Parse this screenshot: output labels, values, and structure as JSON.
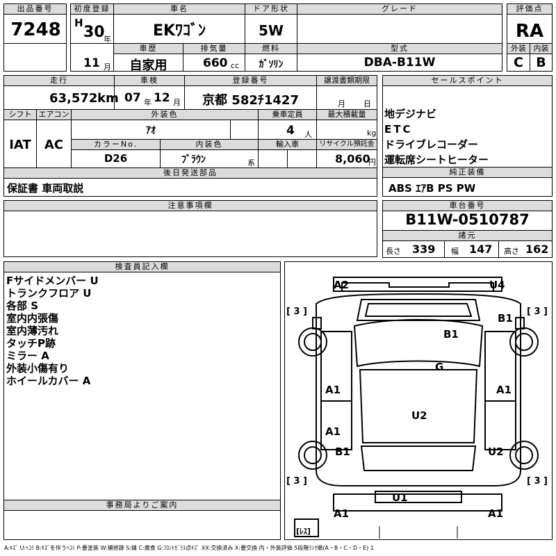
{
  "header": {
    "lot_label": "出品番号",
    "lot_no": "7248",
    "first_reg_label": "初度登録",
    "era": "H",
    "year_no": "30",
    "year_unit": "年",
    "month_no": "11",
    "month_unit": "月",
    "car_name_label": "車名",
    "car_name": "EKﾜｺﾞﾝ",
    "door_label": "ドア形状",
    "door": "5W",
    "grade_label": "グレード",
    "grade": "",
    "score_label": "評価点",
    "score": "RA",
    "history_label": "車歴",
    "history": "自家用",
    "displacement_label": "排気量",
    "displacement": "660",
    "displacement_unit": "cc",
    "fuel_label": "燃料",
    "fuel": "ｶﾞｿﾘﾝ",
    "model_label": "型式",
    "model": "DBA-B11W",
    "ext_label": "外装",
    "ext_grade": "C",
    "int_label": "内装",
    "int_grade": "B"
  },
  "row2": {
    "mileage_label": "走行",
    "mileage": "63,572",
    "mileage_unit": "km",
    "inspection_label": "車検",
    "insp_year": "07",
    "insp_year_unit": "年",
    "insp_month": "12",
    "insp_month_unit": "月",
    "reg_label": "登録番号",
    "reg_no": "京都 582ﾁ1427",
    "transfer_label": "譲渡書類期限",
    "transfer_month_unit": "月",
    "transfer_day_unit": "日",
    "shift_label": "シフト",
    "shift": "IAT",
    "ac_label": "エアコン",
    "ac": "AC",
    "color_label": "外装色",
    "color": "ｱｵ",
    "capacity_label": "乗車定員",
    "capacity": "4",
    "capacity_unit": "人",
    "load_label": "最大積載量",
    "load_unit": "kg",
    "color_no_label": "カラーNo.",
    "color_no": "D26",
    "interior_color_label": "内装色",
    "interior_color": "ﾌﾞﾗｳﾝ",
    "interior_color_unit": "系",
    "import_label": "輸入車",
    "recycle_label": "リサイクル預託金",
    "recycle": "8,060",
    "recycle_unit": "円"
  },
  "sales": {
    "label": "セールスポイント",
    "points": [
      "地デジナビ",
      "ETC",
      "ドライブレコーダー",
      "運転席シートヒーター"
    ]
  },
  "later_parts": {
    "label": "後日発送部品",
    "value": "保証書 車両取説"
  },
  "genuine": {
    "label": "純正装備",
    "value": "ABS ｴｱB PS PW"
  },
  "notes": {
    "label": "注意事項欄",
    "value": ""
  },
  "chassis": {
    "label": "車台番号",
    "value": "B11W-0510787"
  },
  "dims": {
    "label": "諸元",
    "length_label": "長さ",
    "length": "339",
    "width_label": "幅",
    "width": "147",
    "height_label": "高さ",
    "height": "162"
  },
  "inspector": {
    "label": "検査員記入欄",
    "items": [
      "Fサイドメンバー U",
      "トランクフロア U",
      "各部 S",
      "室内内張傷",
      "室内薄汚れ",
      "タッチP跡",
      "ミラー A",
      "外装小傷有り",
      "ホイールカバー A"
    ]
  },
  "office": {
    "label": "事務局よりご案内",
    "value": ""
  },
  "diagram": {
    "marks": [
      "A2",
      "U4",
      "B1",
      "B1",
      "G",
      "A1",
      "A1",
      "A1",
      "U2",
      "B1",
      "U2",
      "U1",
      "A1",
      "A1"
    ],
    "tires": [
      "[ 3 ]",
      "[ 3 ]",
      "[ 3 ]",
      "[ 3 ]"
    ],
    "spare": "[ﾚｽ]"
  },
  "legend": "A:ｷｽﾞ U:ﾍｺﾐ B:ｷｽﾞを伴うﾍｺﾐ P:要塗装 W:補修跡 S:錆 C:腐食 G:ﾌﾛﾝﾄｶﾞﾗｽ点ｷｽﾞ XX:交換済み X:要交換 内・外装評価 5段階ﾗﾝｸ順(A・B・C・D・E) 1"
}
